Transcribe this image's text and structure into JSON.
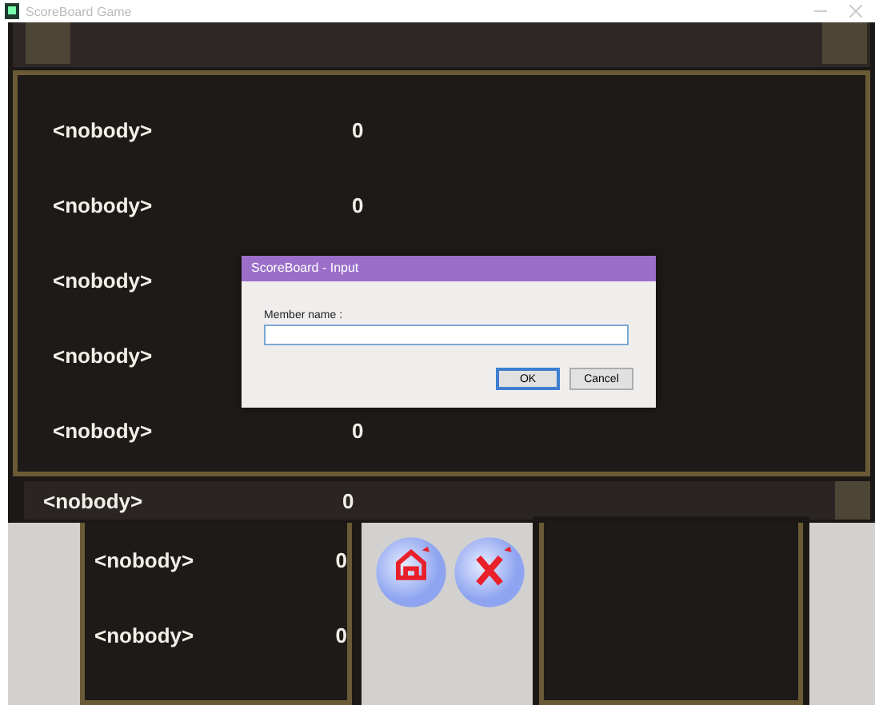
{
  "window": {
    "title": "ScoreBoard Game"
  },
  "board_rows": [
    {
      "name": "<nobody>",
      "score": "0"
    },
    {
      "name": "<nobody>",
      "score": "0"
    },
    {
      "name": "<nobody>"
    },
    {
      "name": "<nobody>"
    },
    {
      "name": "<nobody>",
      "score": "0"
    }
  ],
  "highlight_row": {
    "name": "<nobody>",
    "score": "0"
  },
  "lower_rows": [
    {
      "name": "<nobody>",
      "score": "0"
    },
    {
      "name": "<nobody>",
      "score": "0"
    }
  ],
  "dialog": {
    "title": "ScoreBoard - Input",
    "label": "Member name :",
    "buttons": [
      {
        "label": "OK",
        "default": true
      },
      {
        "label": "Cancel",
        "default": false
      }
    ]
  }
}
